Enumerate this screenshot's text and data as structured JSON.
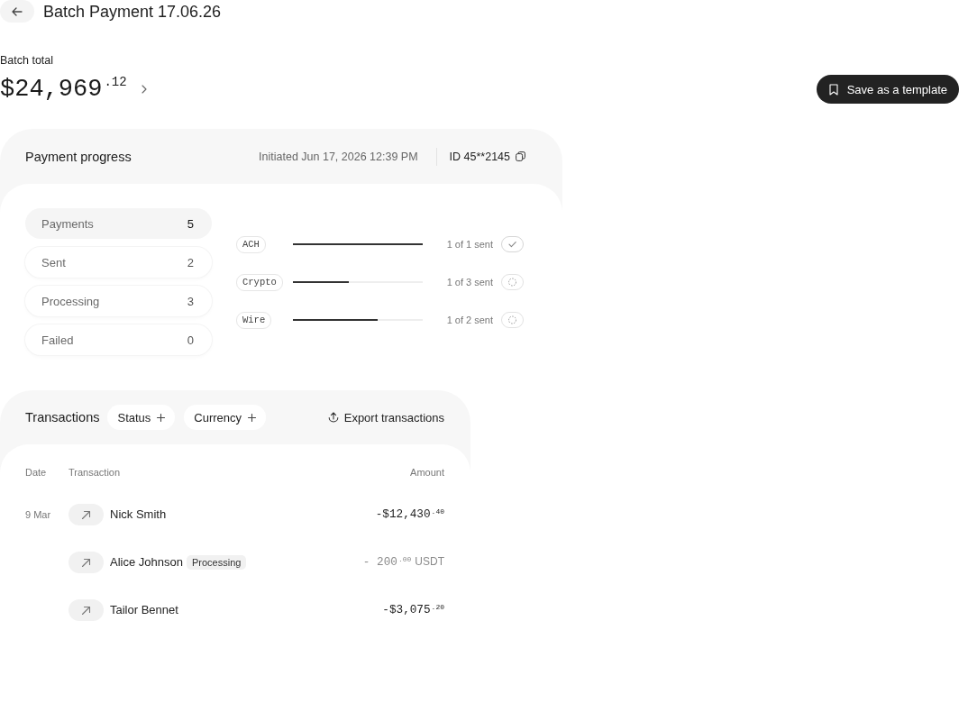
{
  "header": {
    "title": "Batch Payment 17.06.26"
  },
  "summary": {
    "label": "Batch total",
    "amount": "$24,969$^{.12}$"
  },
  "save_button": {
    "label": "Save as a template"
  },
  "progress": {
    "title": "Payment progress",
    "initiated": "Initiated Jun 17, 2026 12:39 PM",
    "batch_id": "ID 45**2145",
    "counts": [
      {
        "label": "Payments",
        "value": "5",
        "selected": true
      },
      {
        "label": "Sent",
        "value": "2",
        "selected": false
      },
      {
        "label": "Processing",
        "value": "3",
        "selected": false
      },
      {
        "label": "Failed",
        "value": "0",
        "selected": false
      }
    ],
    "rails": [
      {
        "name": "ACH",
        "level": 1,
        "reading": "1 of 1 sent",
        "complete": true
      },
      {
        "name": "Crypto",
        "level": 0.43,
        "reading": "1 of 3 sent",
        "complete": false
      },
      {
        "name": "Wire",
        "level": 0.65,
        "reading": "1 of 2 sent",
        "complete": false
      }
    ]
  },
  "transactions": {
    "title": "Transactions",
    "filters": [
      "Status",
      "Currency"
    ],
    "export": "Export transactions",
    "columns": [
      "Date",
      "Transaction",
      "Amount"
    ],
    "rows": [
      {
        "date": "9 Mar",
        "name": "Nick Smith",
        "amount": "-$12,430$^{.40}$",
        "pending": false
      },
      {
        "name": "Alice Johnson",
        "badge": "Processing",
        "amount": "- 200$^{.00}$",
        "currency": "USDT",
        "pending": true
      },
      {
        "name": "Tailor Bennet",
        "amount": "-$3,075$^{.20}$",
        "pending": false
      }
    ]
  }
}
